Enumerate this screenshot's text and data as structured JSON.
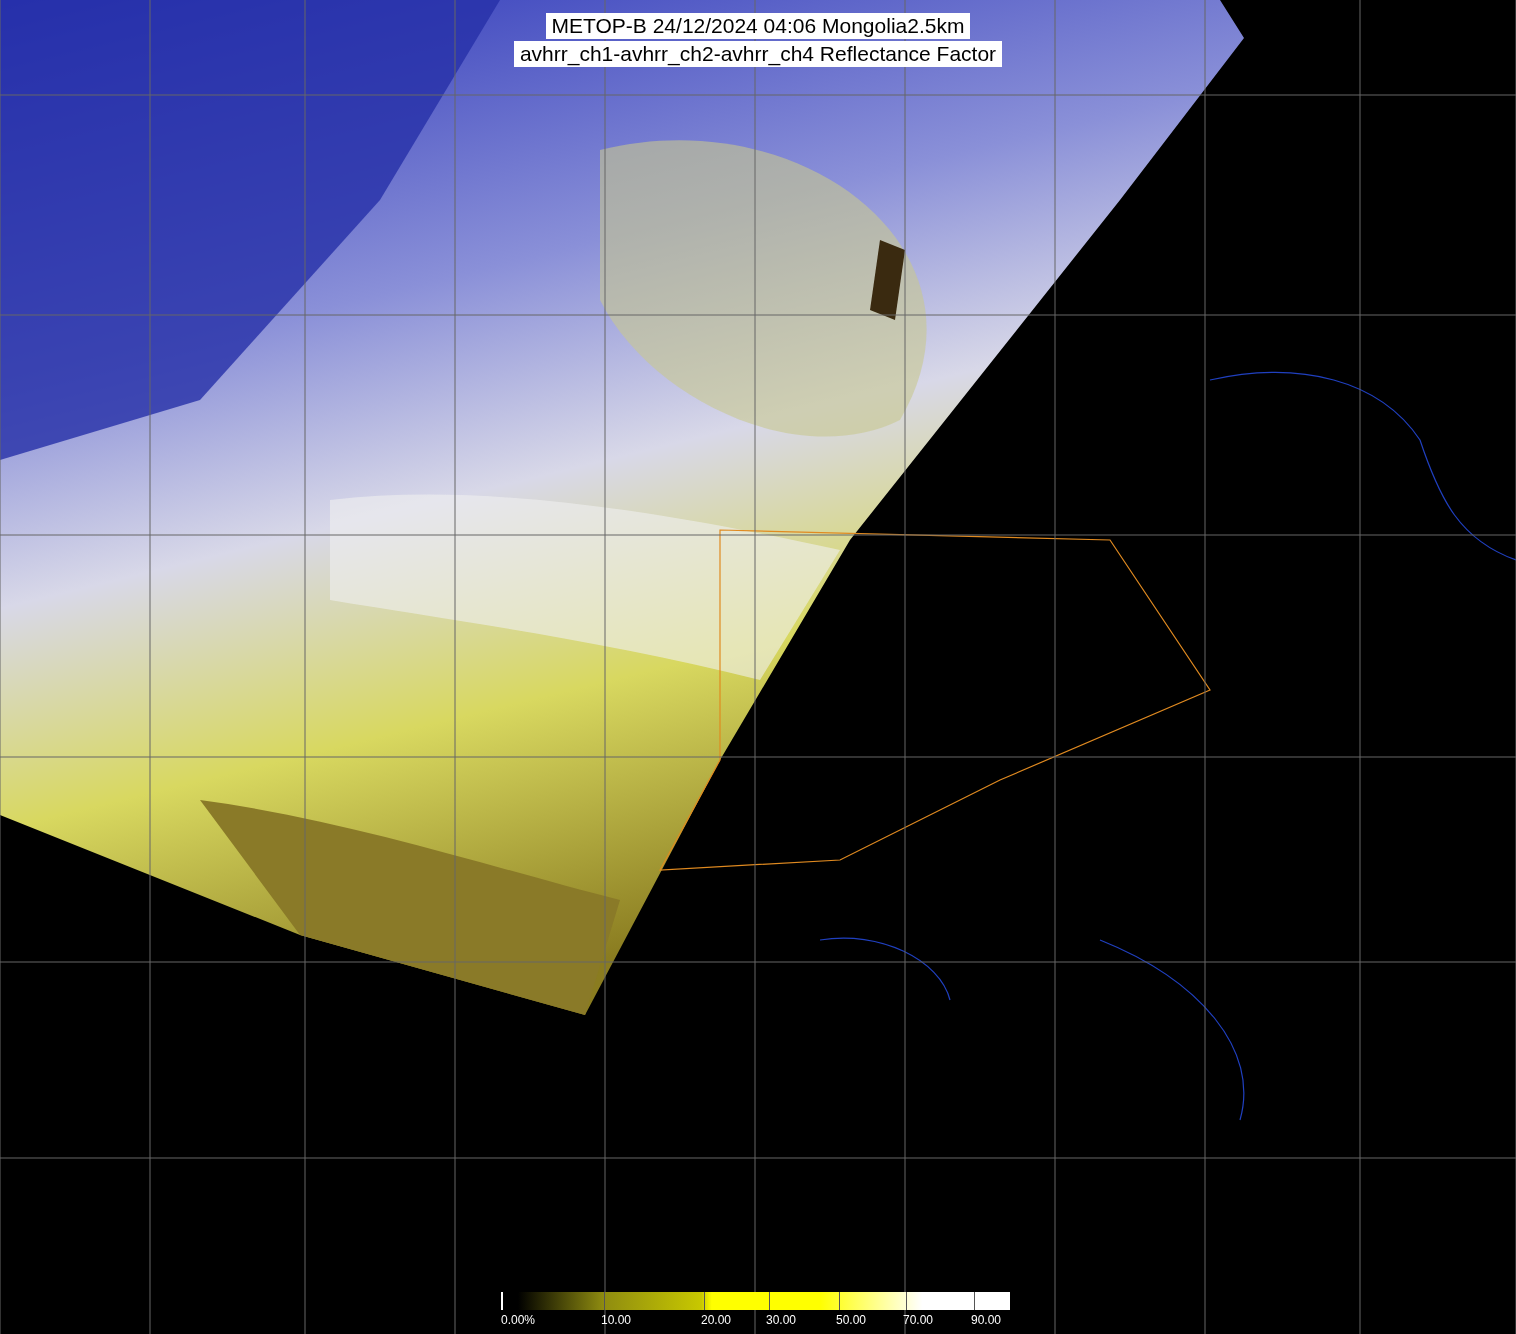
{
  "title": {
    "lines": [
      "METOP-B 24/12/2024 04:06 Mongolia2.5km",
      "avhrr_ch1-avhrr_ch2-avhrr_ch4 Reflectance Factor"
    ]
  },
  "legend": {
    "labels": [
      "0.00%",
      "10.00",
      "20.00",
      "30.00",
      "50.00",
      "70.00",
      "90.00"
    ]
  }
}
